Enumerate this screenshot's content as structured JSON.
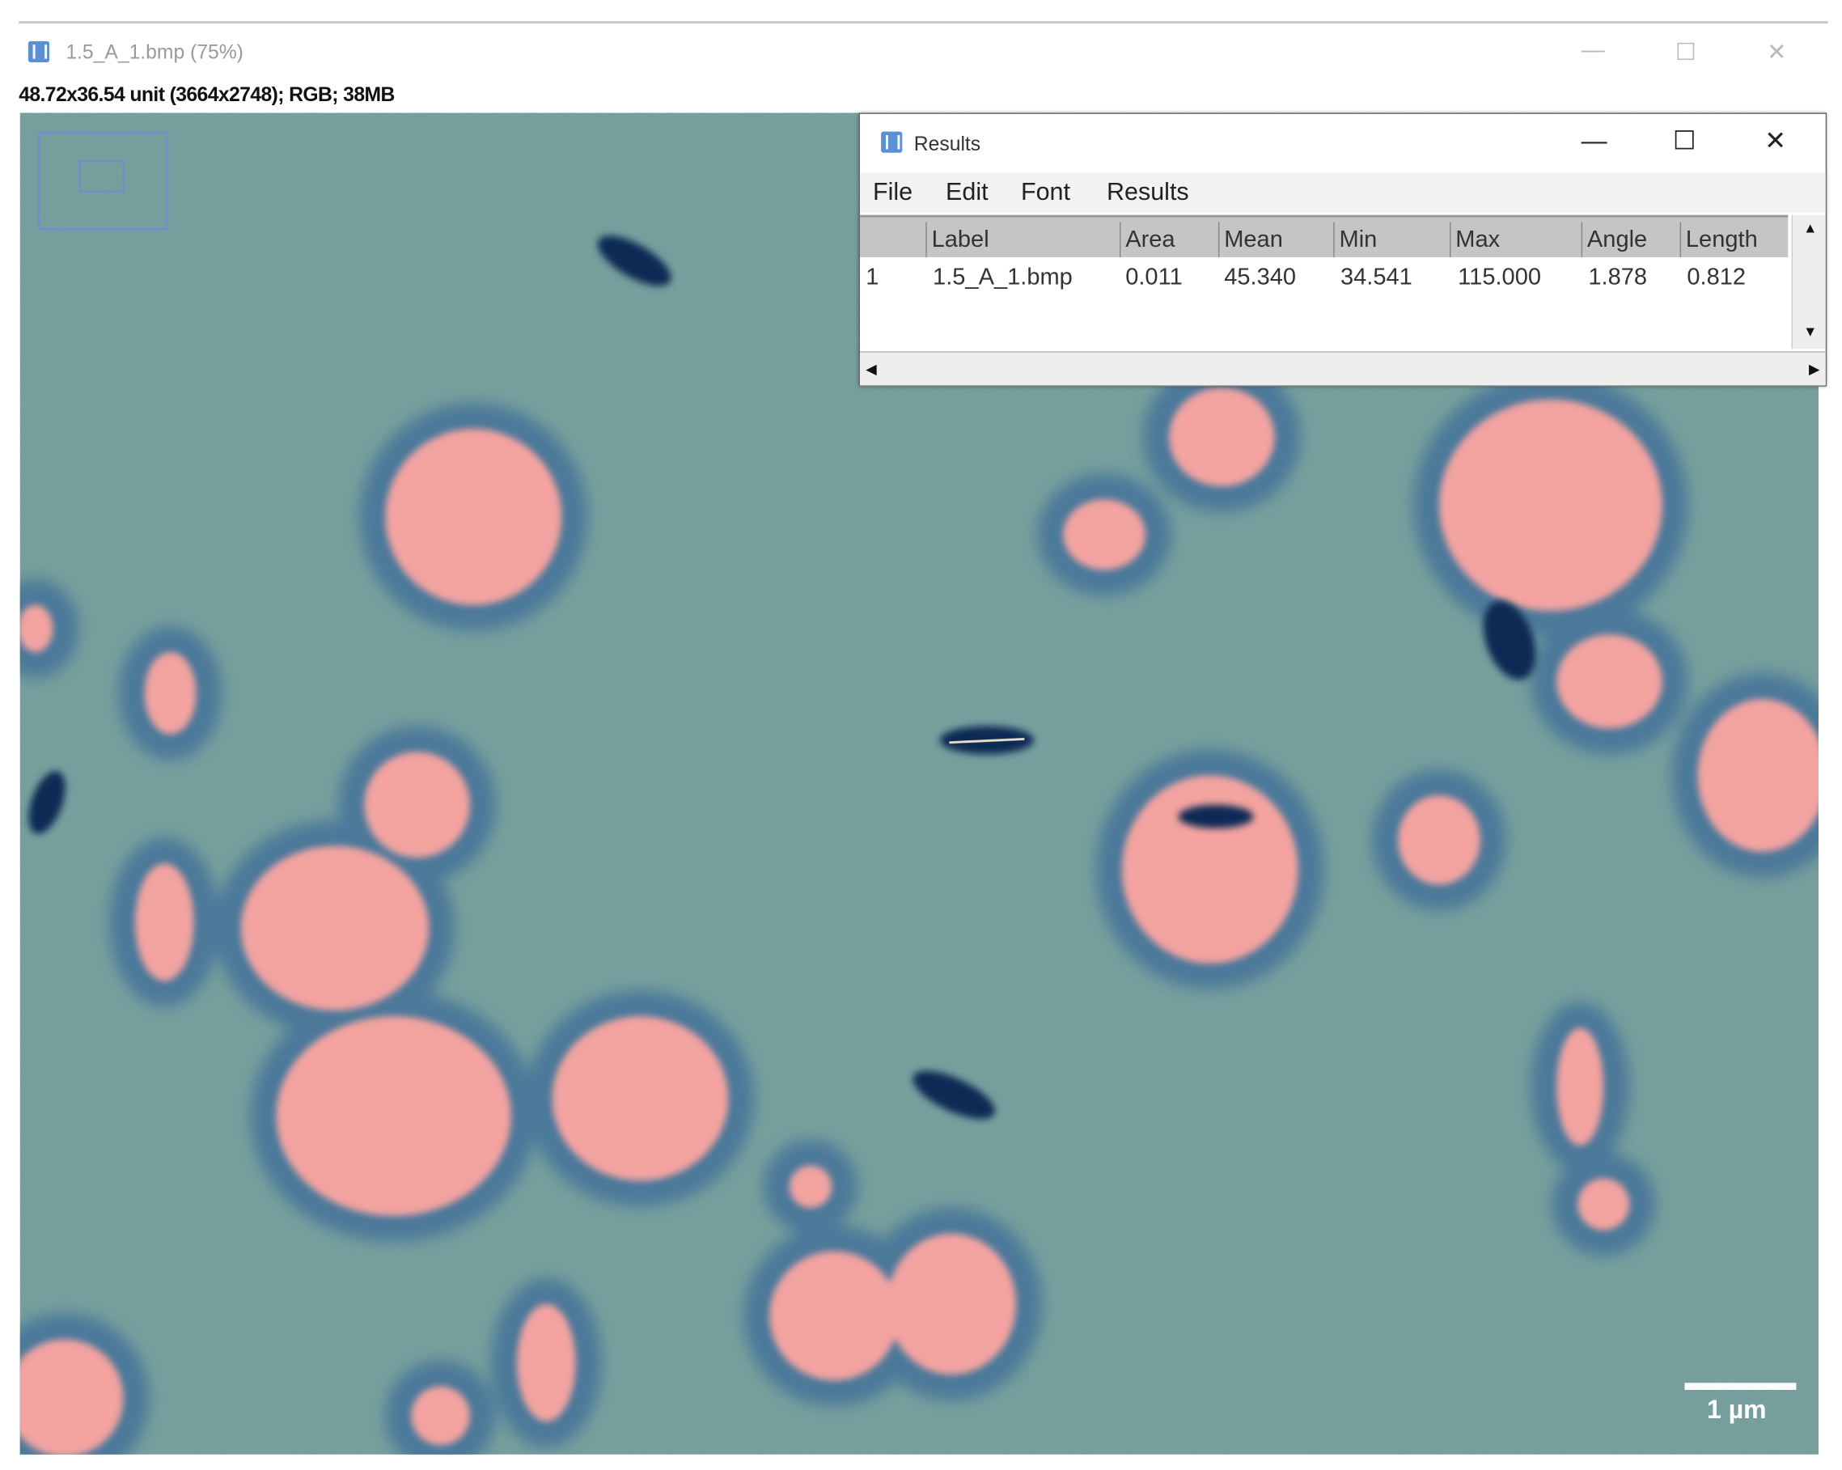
{
  "image_window": {
    "title": "1.5_A_1.bmp (75%)",
    "info": "48.72x36.54 unit (3664x2748); RGB; 38MB",
    "controls": {
      "minimize": "—",
      "maximize": "☐",
      "close": "✕"
    },
    "scale_bar_label": "1 µm"
  },
  "results_window": {
    "title": "Results",
    "menu": [
      "File",
      "Edit",
      "Font",
      "Results"
    ],
    "columns": [
      "",
      "Label",
      "Area",
      "Mean",
      "Min",
      "Max",
      "Angle",
      "Length"
    ],
    "rows": [
      [
        "1",
        "1.5_A_1.bmp",
        "0.011",
        "45.340",
        "34.541",
        "115.000",
        "1.878",
        "0.812"
      ]
    ],
    "controls": {
      "minimize": "—",
      "maximize": "☐",
      "close": "✕"
    }
  },
  "colors": {
    "background": "#6f9896",
    "cell": "#f3a3a0",
    "halo": "#3f6f90",
    "rod": "#0d2c55"
  }
}
